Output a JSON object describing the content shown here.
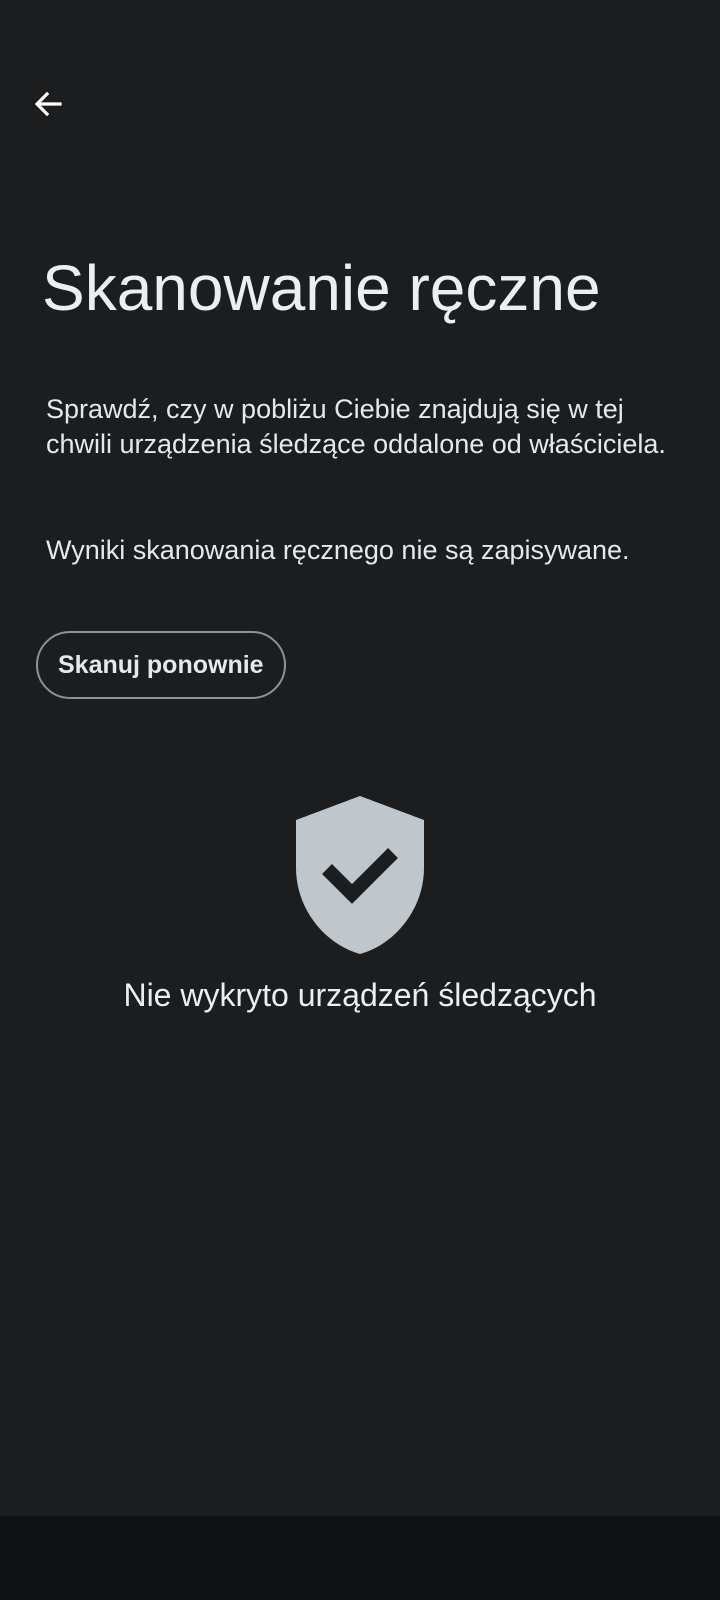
{
  "header": {
    "back_icon": "arrow-back-icon"
  },
  "main": {
    "title": "Skanowanie ręczne",
    "description": "Sprawdź, czy w pobliżu Ciebie znajdują się w tej chwili urządzenia śledzące oddalone od właściciela.",
    "note": "Wyniki skanowania ręcznego nie są zapisywane.",
    "rescan_label": "Skanuj ponownie"
  },
  "result": {
    "icon": "shield-check-icon",
    "icon_color": "#c0c7cc",
    "text": "Nie wykryto urządzeń śledzących"
  },
  "colors": {
    "background": "#1b1d1f",
    "nav_bar": "#101113",
    "button_border": "#8e9296"
  }
}
